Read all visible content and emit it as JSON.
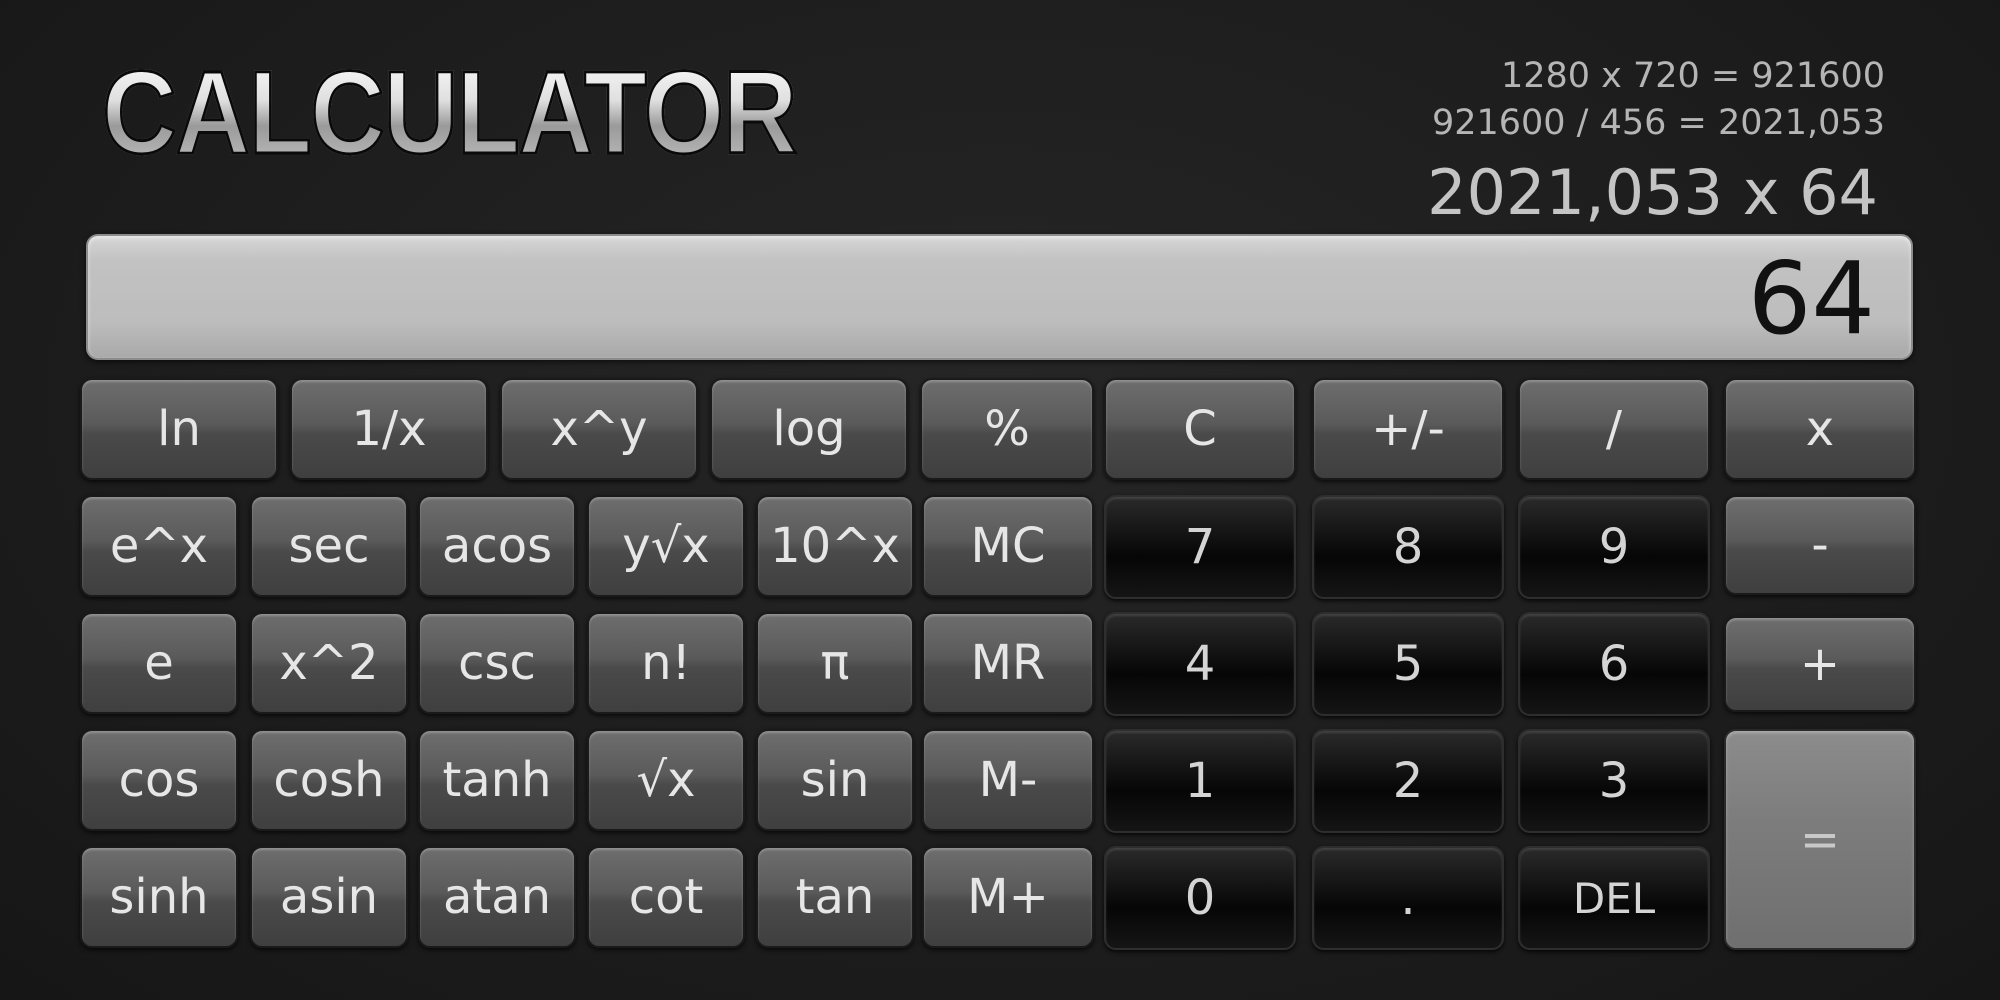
{
  "app": {
    "title": "CALCULATOR"
  },
  "history": {
    "line1": "1280 x 720 = 921600",
    "line2": "921600 / 456 = 2021,053",
    "expression": "2021,053 x 64"
  },
  "display": {
    "value": "64"
  },
  "keys": {
    "ln": "ln",
    "reciprocal": "1/x",
    "power": "x^y",
    "log": "log",
    "percent": "%",
    "clear": "C",
    "negate": "+/-",
    "divide": "/",
    "multiply": "x",
    "exp": "e^x",
    "sec": "sec",
    "acos": "acos",
    "yroot": "y√x",
    "pow10": "10^x",
    "mc": "MC",
    "d7": "7",
    "d8": "8",
    "d9": "9",
    "subtract": "-",
    "e": "e",
    "square": "x^2",
    "csc": "csc",
    "factorial": "n!",
    "pi": "π",
    "mr": "MR",
    "d4": "4",
    "d5": "5",
    "d6": "6",
    "add": "+",
    "cos": "cos",
    "cosh": "cosh",
    "tanh": "tanh",
    "sqrt": "√x",
    "sin": "sin",
    "mminus": "M-",
    "d1": "1",
    "d2": "2",
    "d3": "3",
    "equals": "=",
    "sinh": "sinh",
    "asin": "asin",
    "atan": "atan",
    "cot": "cot",
    "tan": "tan",
    "mplus": "M+",
    "d0": "0",
    "decimal": ".",
    "del": "DEL"
  }
}
